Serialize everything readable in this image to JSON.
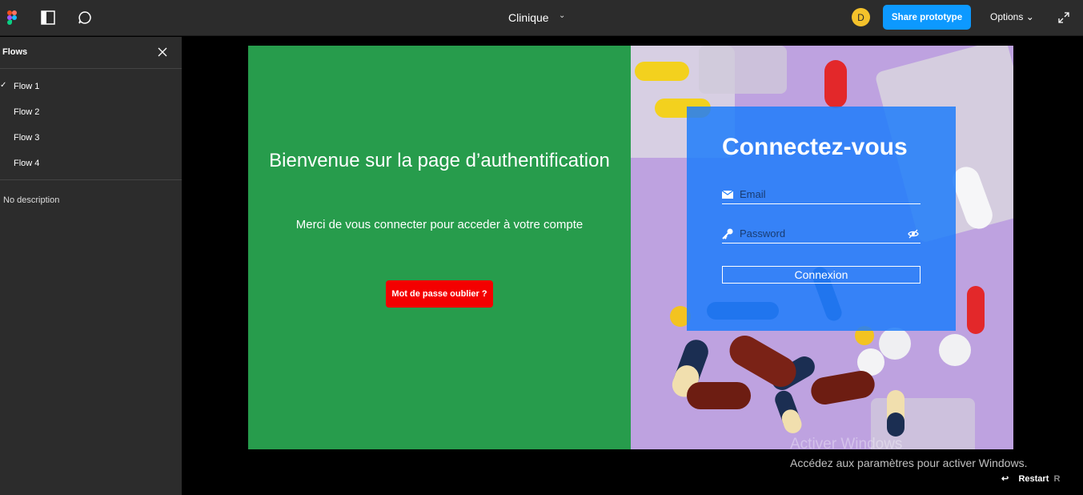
{
  "topbar": {
    "doc_title": "Clinique",
    "avatar_initial": "D",
    "share_label": "Share prototype",
    "options_label": "Options"
  },
  "sidebar": {
    "title": "Flows",
    "flows": [
      {
        "label": "Flow 1",
        "selected": true
      },
      {
        "label": "Flow 2",
        "selected": false
      },
      {
        "label": "Flow 3",
        "selected": false
      },
      {
        "label": "Flow 4",
        "selected": false
      }
    ],
    "description": "No description"
  },
  "prototype": {
    "welcome_title": "Bienvenue sur la page d’authentification",
    "subtitle": "Merci de vous connecter pour acceder à votre compte",
    "forgot_label": "Mot de passe oublier ?",
    "login_title": "Connectez-vous",
    "email_placeholder": "Email",
    "password_placeholder": "Password",
    "connexion_label": "Connexion"
  },
  "watermark": {
    "title": "Activer Windows",
    "subtitle": "Accédez aux paramètres pour activer Windows."
  },
  "footer": {
    "restart_label": "Restart",
    "restart_shortcut": "R"
  },
  "colors": {
    "accent": "#0d99ff",
    "left_pane": "#279c4c",
    "forgot_button": "#f40000",
    "login_card": "#1e7dfa"
  }
}
